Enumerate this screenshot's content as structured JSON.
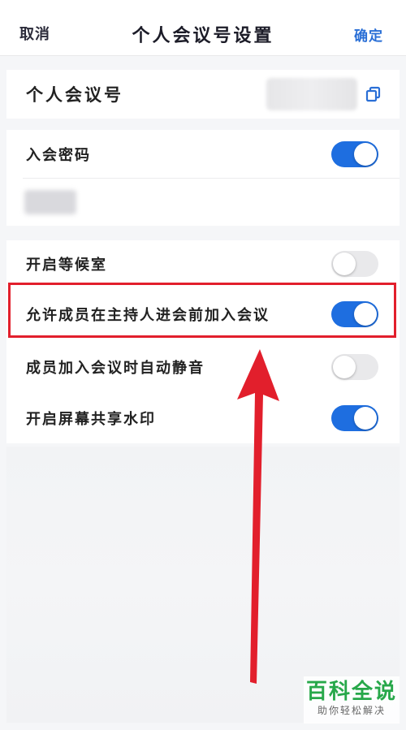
{
  "header": {
    "cancel_label": "取消",
    "title": "个人会议号设置",
    "confirm_label": "确定"
  },
  "meeting_number": {
    "label": "个人会议号"
  },
  "password": {
    "label": "入会密码",
    "enabled": true
  },
  "settings": [
    {
      "label": "开启等候室",
      "enabled": false
    },
    {
      "label": "允许成员在主持人进会前加入会议",
      "enabled": true
    },
    {
      "label": "成员加入会议时自动静音",
      "enabled": false
    },
    {
      "label": "开启屏幕共享水印",
      "enabled": true
    }
  ],
  "colors": {
    "accent": "#1e6ee0",
    "highlight": "#e21f2c",
    "watermark": "#27a84a"
  },
  "watermark": {
    "title": "百科全说",
    "subtitle": "助你轻松解决"
  }
}
